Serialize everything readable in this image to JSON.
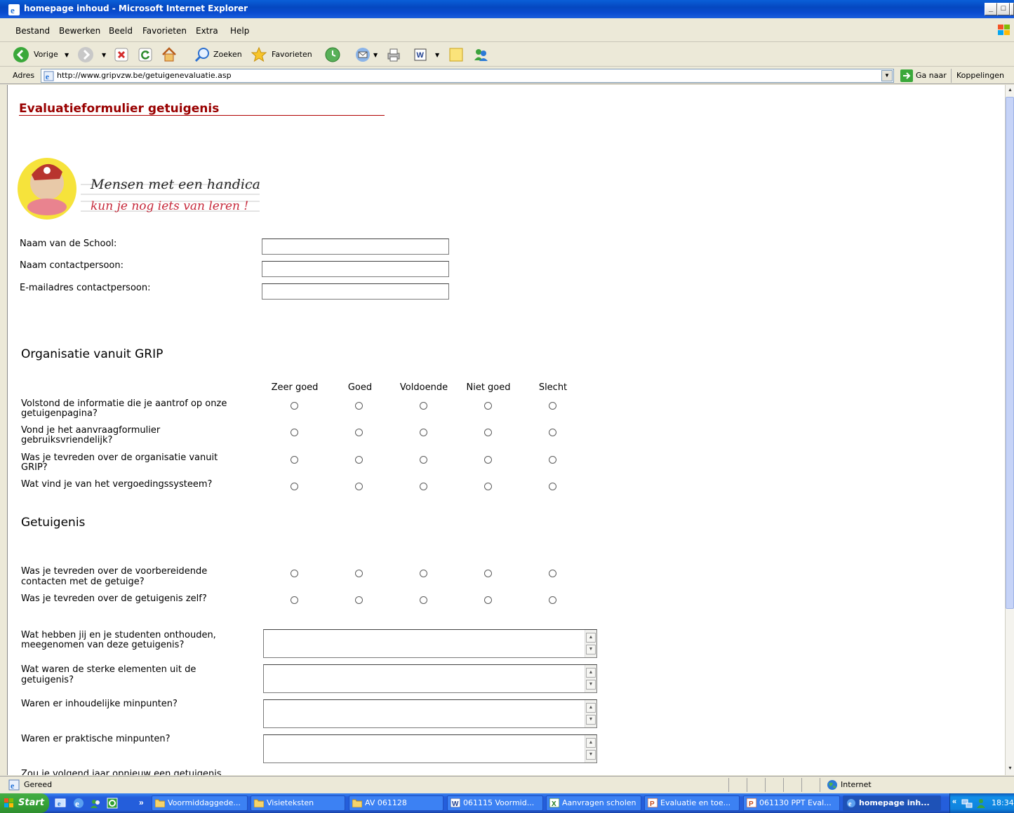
{
  "window": {
    "title": "homepage inhoud - Microsoft Internet Explorer",
    "buttons": [
      "_",
      "□",
      "×"
    ]
  },
  "menu": [
    "Bestand",
    "Bewerken",
    "Beeld",
    "Favorieten",
    "Extra",
    "Help"
  ],
  "toolbar": {
    "back": "Vorige",
    "search": "Zoeken",
    "favorites": "Favorieten"
  },
  "address": {
    "label": "Adres",
    "url": "http://www.gripvzw.be/getuigenevaluatie.asp",
    "go": "Ga naar",
    "links": "Koppelingen"
  },
  "page": {
    "title": "Evaluatieformulier getuigenis",
    "logo_line1": "Mensen met een handicap",
    "logo_line2": "kun je nog iets van leren !",
    "fields": [
      {
        "label": "Naam van de School:",
        "value": ""
      },
      {
        "label": "Naam contactpersoon:",
        "value": ""
      },
      {
        "label": "E-mailadres contactpersoon:",
        "value": ""
      }
    ],
    "section1": "Organisatie vanuit GRIP",
    "columns": [
      "Zeer goed",
      "Goed",
      "Voldoende",
      "Niet goed",
      "Slecht"
    ],
    "questions1": [
      {
        "line1": "Volstond de informatie die je aantrof op onze",
        "line2": "getuigenpagina?"
      },
      {
        "line1": "Vond je het aanvraagformulier",
        "line2": "gebruiksvriendelijk?"
      },
      {
        "line1": "Was je tevreden over de organisatie vanuit",
        "line2": "GRIP?"
      },
      {
        "line1": "Wat vind je van het vergoedingssysteem?",
        "line2": ""
      }
    ],
    "section2": "Getuigenis",
    "questions2": [
      {
        "line1": "Was je tevreden over de voorbereidende",
        "line2": "contacten met de getuige?"
      },
      {
        "line1": "Was je tevreden over de getuigenis zelf?",
        "line2": ""
      }
    ],
    "open_questions": [
      {
        "line1": "Wat hebben jij en je studenten onthouden,",
        "line2": "meegenomen van deze getuigenis?"
      },
      {
        "line1": "Wat waren de sterke elementen uit de",
        "line2": "getuigenis?"
      },
      {
        "line1": "Waren er inhoudelijke minpunten?",
        "line2": ""
      },
      {
        "line1": "Waren er praktische minpunten?",
        "line2": ""
      }
    ],
    "cut_text": "Zou je volgend jaar opnieuw een getuigenis"
  },
  "status": {
    "text": "Gereed",
    "zone": "Internet"
  },
  "taskbar": {
    "start": "Start",
    "chevron": "»",
    "tasks": [
      "Voormiddaggede...",
      "Visieteksten",
      "AV 061128",
      "061115 Voormid...",
      "Aanvragen scholen",
      "Evaluatie en toe...",
      "061130 PPT Eval...",
      "homepage inh..."
    ],
    "tray_chevron": "«",
    "clock": "18:34"
  },
  "colors": {
    "title_red": "#990000",
    "xp_blue": "#245edb"
  }
}
